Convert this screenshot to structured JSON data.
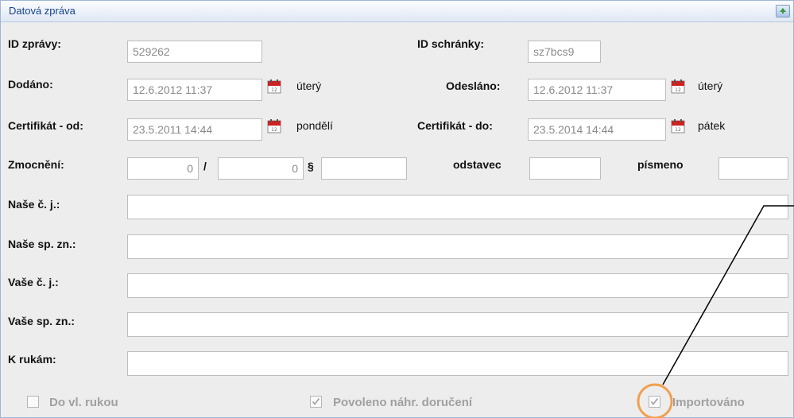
{
  "panel": {
    "title": "Datová zpráva"
  },
  "row1": {
    "id_zpravy_label": "ID zprávy:",
    "id_zpravy_value": "529262",
    "id_schranky_label": "ID schránky:",
    "id_schranky_value": "sz7bcs9"
  },
  "row2": {
    "dodano_label": "Dodáno:",
    "dodano_value": "12.6.2012 11:37",
    "dodano_day": "úterý",
    "odeslano_label": "Odesláno:",
    "odeslano_value": "12.6.2012 11:37",
    "odeslano_day": "úterý"
  },
  "row3": {
    "cert_od_label": "Certifikát - od:",
    "cert_od_value": "23.5.2011 14:44",
    "cert_od_day": "pondělí",
    "cert_do_label": "Certifikát - do:",
    "cert_do_value": "23.5.2014 14:44",
    "cert_do_day": "pátek"
  },
  "row4": {
    "zmocneni_label": "Zmocnění:",
    "zmocneni_1": "0",
    "slash": "/",
    "zmocneni_2": "0",
    "paragraph": "§",
    "zmocneni_3": "",
    "odstavec_label": "odstavec",
    "odstavec_value": "",
    "pismeno_label": "písmeno",
    "pismeno_value": ""
  },
  "refs": {
    "nase_cj_label": "Naše č. j.:",
    "nase_cj_value": "",
    "nase_spzn_label": "Naše sp. zn.:",
    "nase_spzn_value": "",
    "vase_cj_label": "Vaše č. j.:",
    "vase_cj_value": "",
    "vase_spzn_label": "Vaše sp. zn.:",
    "vase_spzn_value": "",
    "k_rukam_label": "K rukám:",
    "k_rukam_value": ""
  },
  "checkboxes": {
    "do_vl_rukou": {
      "label": "Do vl. rukou",
      "checked": false
    },
    "povoleno": {
      "label": "Povoleno náhr. doručení",
      "checked": true
    },
    "importovano": {
      "label": "Importováno",
      "checked": true
    }
  },
  "icons": {
    "calendar": "calendar-icon",
    "collapse": "collapse-panel-icon",
    "check": "check-icon"
  },
  "colors": {
    "highlight_circle": "#f0a050",
    "title_text": "#15428b"
  }
}
